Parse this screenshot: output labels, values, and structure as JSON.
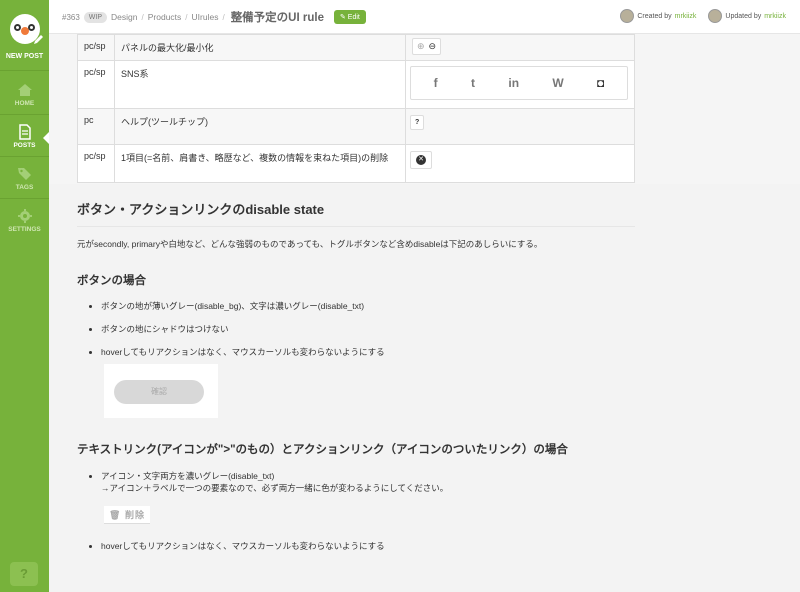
{
  "sidebar": {
    "new_post": "NEW POST",
    "items": [
      {
        "label": "HOME",
        "icon": "home-icon"
      },
      {
        "label": "POSTS",
        "icon": "document-icon"
      },
      {
        "label": "TAGS",
        "icon": "tag-icon"
      },
      {
        "label": "SETTINGS",
        "icon": "gear-icon"
      }
    ],
    "help": "?",
    "accent": "#77b23b"
  },
  "header": {
    "number": "#363",
    "wip": "WIP",
    "breadcrumbs": [
      "Design",
      "Products",
      "UIrules"
    ],
    "title": "整備予定のUI rule",
    "edit_label": "Edit",
    "created_by_label": "Created by",
    "created_by_user": "mrkiizk",
    "updated_by_label": "Updated by",
    "updated_by_user": "mrkiizk"
  },
  "table": {
    "rows": [
      {
        "platform": "pc/sp",
        "desc": "パネルの最大化/最小化"
      },
      {
        "platform": "pc/sp",
        "desc": "SNS系",
        "sns": [
          "f",
          "t",
          "in",
          "W",
          "◘"
        ]
      },
      {
        "platform": "pc",
        "desc": "ヘルプ(ツールチップ)"
      },
      {
        "platform": "pc/sp",
        "desc": "1項目(=名前、肩書き、略歴など、複数の情報を束ねた項目)の削除"
      }
    ]
  },
  "section": {
    "heading": "ボタン・アクションリンクのdisable state",
    "intro": "元がsecondly, primaryや白地など、どんな強弱のものであっても、トグルボタンなど含めdisableは下記のあしらいにする。",
    "buttons_heading": "ボタンの場合",
    "buttons_items": [
      "ボタンの地が薄いグレー(disable_bg)、文字は濃いグレー(disable_txt)",
      "ボタンの地にシャドウはつけない",
      "hoverしてもリアクションはなく、マウスカーソルも変わらないようにする"
    ],
    "demo_button": "確認",
    "links_heading": "テキストリンク(アイコンが\">\"のもの）とアクションリンク（アイコンのついたリンク）の場合",
    "links_item1_line1": "アイコン・文字両方を濃いグレー(disable_txt)",
    "links_item1_line2": "→アイコン＋ラベルで一つの要素なので、必ず両方一緒に色が変わるようにしてください。",
    "delete_label": "削除",
    "links_item2": "hoverしてもリアクションはなく、マウスカーソルも変わらないようにする"
  }
}
